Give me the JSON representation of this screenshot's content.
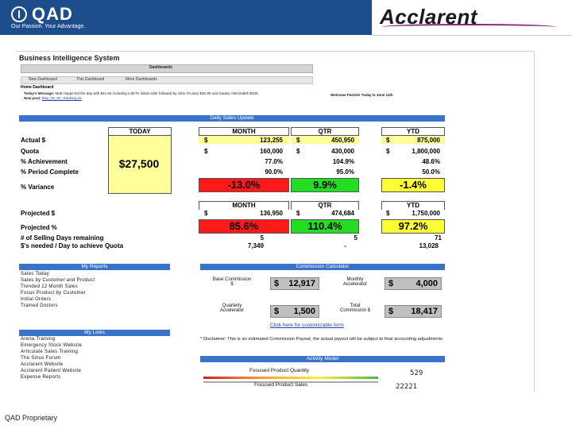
{
  "header": {
    "qad_name": "QAD",
    "qad_tagline": "Our Passion. Your Advantage.",
    "partner_name": "Acclarent"
  },
  "app": {
    "title": "Business Intelligence System",
    "dashboards_label": "Dashboards",
    "nav": [
      "New Dashboard",
      "This Dashboard",
      "More Dashboards"
    ],
    "home_dashboard": "Home Dashboard",
    "message_label": "Today's Message:",
    "message_text": "Matt Hoppe led the day with $41.6K including a $17K initial order followed by John O'Leary $30.3K and Cauley Alemzadeh $22K.",
    "new_post_label": "New post:",
    "new_post_link": "May_05_SF_Ranking.xls",
    "welcome": "Welcome Patrick! Today is June 11th"
  },
  "sales": {
    "section_title": "Daily Sales Update",
    "col_today": "TODAY",
    "col_month": "MONTH",
    "col_qtr": "QTR",
    "col_ytd": "YTD",
    "rows": {
      "actual": "Actual $",
      "quota": "Quota",
      "achievement": "% Achievement",
      "period_complete": "% Period Complete",
      "variance": "% Variance",
      "projected_dollar": "Projected $",
      "projected_pct": "Projected %",
      "selling_days": "# of Selling Days remaining",
      "per_day": "$'s needed / Day to achieve Quota"
    },
    "currency": "$",
    "today_value": "$27,500",
    "month": {
      "actual": "123,255",
      "quota": "160,000",
      "achievement": "77.0%",
      "period": "90.0%",
      "variance": "-13.0%",
      "projected": "136,950",
      "projected_pct": "85.6%",
      "days": "5",
      "per_day": "7,349"
    },
    "qtr": {
      "actual": "450,950",
      "quota": "430,000",
      "achievement": "104.9%",
      "period": "95.0%",
      "variance": "9.9%",
      "projected": "474,684",
      "projected_pct": "110.4%",
      "days": "5",
      "per_day": "-"
    },
    "ytd": {
      "actual": "875,000",
      "quota": "1,800,000",
      "achievement": "48.6%",
      "period": "50.0%",
      "variance": "-1.4%",
      "projected": "1,750,000",
      "projected_pct": "97.2%",
      "days": "71",
      "per_day": "13,028"
    },
    "colors": {
      "red": "#ff1a1a",
      "green": "#22dd22",
      "yellow": "#ffff33",
      "highlight": "#ffff99"
    }
  },
  "reports": {
    "title": "My Reports",
    "items": [
      "Sales Today",
      "Sales by Customer and Product",
      "Trended 12 Month Sales",
      "Focus Product by Customer",
      "Initial Orders",
      "Trained Doctors"
    ]
  },
  "links": {
    "title": "My Links",
    "items": [
      "Arena Training",
      "Emergency Stock Website",
      "Articulate Sales Training",
      "The Sinus Forum",
      "Acclarent Website",
      "Acclarent Patient Website",
      "Expense Reports"
    ]
  },
  "commission": {
    "title": "Commission Calculator",
    "base_label_1": "Base Commission",
    "base_label_2": "$",
    "base_value": "12,917",
    "monthly_label_1": "Monthly",
    "monthly_label_2": "Accelerator",
    "monthly_value": "4,000",
    "quarterly_label_1": "Quarterly",
    "quarterly_label_2": "Accelerator",
    "quarterly_value": "1,500",
    "total_label_1": "Total",
    "total_label_2": "Commission $",
    "total_value": "18,417",
    "custom_link": "Click here for customizable form",
    "disclaimer": "* Disclaimer:  This is an estimated Commission Payout, the actual payout will be subject to final accounting adjustments"
  },
  "activity": {
    "title": "Activity Model",
    "quantity_label": "Focused Product Quantity",
    "quantity_value": "529",
    "sales_label": "Focused Product Sales",
    "sales_value": "22221"
  },
  "footer": "QAD Proprietary"
}
